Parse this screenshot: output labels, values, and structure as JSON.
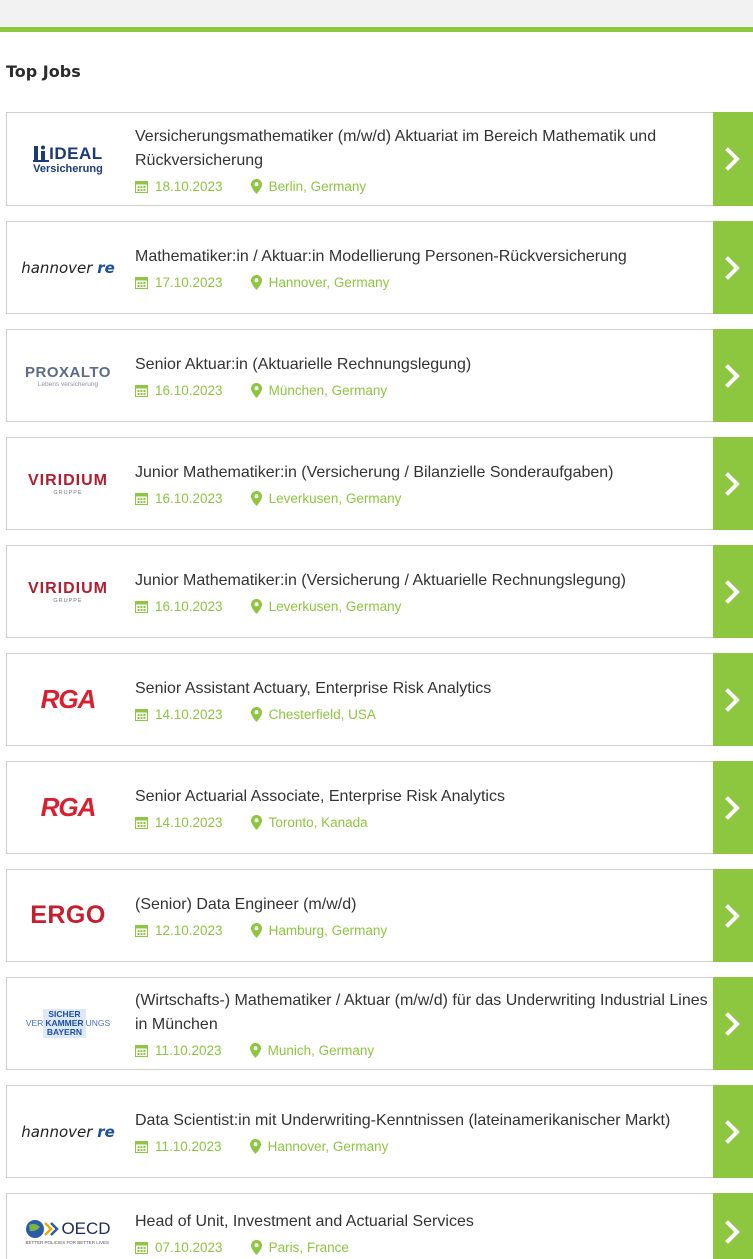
{
  "section_title": "Top Jobs",
  "colors": {
    "accent": "#8dc63f",
    "title_text": "#333333",
    "border": "#cfcfcf"
  },
  "jobs": [
    {
      "logo": {
        "kind": "ideal",
        "line1": "IDEAL",
        "line2": "Versicherung"
      },
      "title": "Versicherungsmathematiker (m/w/d) Aktuariat im Bereich Mathematik und Rückversicherung",
      "date": "18.10.2023",
      "location": "Berlin, Germany"
    },
    {
      "logo": {
        "kind": "hannover",
        "line1": "hannover",
        "line2": "re"
      },
      "title": "Mathematiker:in / Aktuar:in Modellierung Personen-Rückversicherung",
      "date": "17.10.2023",
      "location": "Hannover, Germany"
    },
    {
      "logo": {
        "kind": "proxalto",
        "line1": "PROXALTO",
        "line2": "Lebens versicherung"
      },
      "title": "Senior Aktuar:in (Aktuarielle Rechnungslegung)",
      "date": "16.10.2023",
      "location": "München, Germany"
    },
    {
      "logo": {
        "kind": "viridium",
        "line1": "VIRIDIUM",
        "line2": "GRUPPE"
      },
      "title": "Junior Mathematiker:in (Versicherung / Bilanzielle Sonderaufgaben)",
      "date": "16.10.2023",
      "location": "Leverkusen, Germany"
    },
    {
      "logo": {
        "kind": "viridium",
        "line1": "VIRIDIUM",
        "line2": "GRUPPE"
      },
      "title": "Junior Mathematiker:in (Versicherung / Aktuarielle Rechnungslegung)",
      "date": "16.10.2023",
      "location": "Leverkusen, Germany"
    },
    {
      "logo": {
        "kind": "rga",
        "line1": "RGA",
        "line2": ""
      },
      "title": "Senior Assistant Actuary, Enterprise Risk Analytics",
      "date": "14.10.2023",
      "location": "Chesterfield, USA"
    },
    {
      "logo": {
        "kind": "rga",
        "line1": "RGA",
        "line2": ""
      },
      "title": "Senior Actuarial Associate, Enterprise Risk Analytics",
      "date": "14.10.2023",
      "location": "Toronto, Kanada"
    },
    {
      "logo": {
        "kind": "ergo",
        "line1": "ERGO",
        "line2": ""
      },
      "title": "(Senior) Data Engineer (m/w/d)",
      "date": "12.10.2023",
      "location": "Hamburg, Germany"
    },
    {
      "logo": {
        "kind": "vkb",
        "line1": "VER",
        "line2": "SICHER",
        "line3": "KAMMER",
        "line4": "BAYERN",
        "line5": "UNGS"
      },
      "title": "(Wirtschafts-) Mathematiker / Aktuar (m/w/d) für das Underwriting Industrial Lines in München",
      "date": "11.10.2023",
      "location": "Munich, Germany"
    },
    {
      "logo": {
        "kind": "hannover",
        "line1": "hannover",
        "line2": "re"
      },
      "title": "Data Scientist:in mit Underwriting-Kenntnissen (lateinamerikanischer Markt)",
      "date": "11.10.2023",
      "location": "Hannover, Germany"
    },
    {
      "logo": {
        "kind": "oecd",
        "line1": "OECD",
        "line2": "BETTER POLICIES FOR BETTER LIVES"
      },
      "title": "Head of Unit, Investment and Actuarial Services",
      "date": "07.10.2023",
      "location": "Paris, France"
    }
  ]
}
